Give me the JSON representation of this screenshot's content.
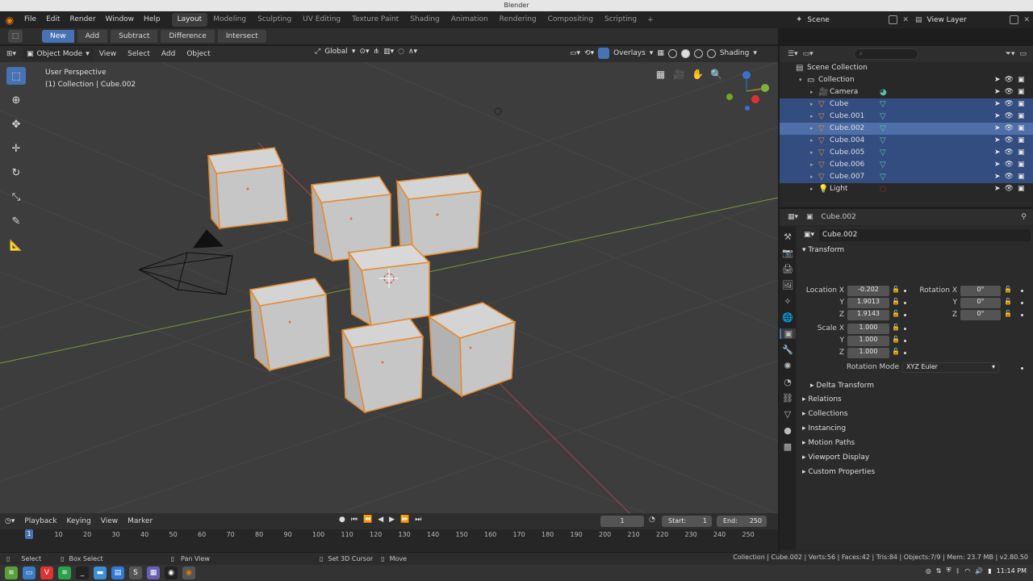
{
  "window": {
    "title": "Blender"
  },
  "menubar": {
    "items": [
      "File",
      "Edit",
      "Render",
      "Window",
      "Help"
    ],
    "workspaces": [
      "Layout",
      "Modeling",
      "Sculpting",
      "UV Editing",
      "Texture Paint",
      "Shading",
      "Animation",
      "Rendering",
      "Compositing",
      "Scripting"
    ],
    "add_workspace": "+",
    "scene_name": "Scene",
    "view_layer_name": "View Layer"
  },
  "toolheader": {
    "buttons": [
      "New",
      "Add",
      "Subtract",
      "Difference",
      "Intersect"
    ]
  },
  "viewport_header": {
    "mode": "Object Mode",
    "menus": [
      "View",
      "Select",
      "Add",
      "Object"
    ],
    "orientation": "Global",
    "overlays": "Overlays",
    "shading": "Shading"
  },
  "viewport": {
    "view_name": "User Perspective",
    "context_line": "(1) Collection | Cube.002"
  },
  "outliner": {
    "search_placeholder": "",
    "rows": [
      {
        "label": "Scene Collection",
        "indent": 0,
        "type": "scene",
        "state": "none"
      },
      {
        "label": "Collection",
        "indent": 1,
        "type": "collection",
        "state": "none"
      },
      {
        "label": "Camera",
        "indent": 2,
        "type": "camera",
        "state": "none"
      },
      {
        "label": "Cube",
        "indent": 2,
        "type": "mesh",
        "state": "selected"
      },
      {
        "label": "Cube.001",
        "indent": 2,
        "type": "mesh",
        "state": "selected"
      },
      {
        "label": "Cube.002",
        "indent": 2,
        "type": "mesh",
        "state": "active"
      },
      {
        "label": "Cube.004",
        "indent": 2,
        "type": "mesh",
        "state": "selected"
      },
      {
        "label": "Cube.005",
        "indent": 2,
        "type": "mesh",
        "state": "selected"
      },
      {
        "label": "Cube.006",
        "indent": 2,
        "type": "mesh",
        "state": "selected"
      },
      {
        "label": "Cube.007",
        "indent": 2,
        "type": "mesh",
        "state": "selected"
      },
      {
        "label": "Light",
        "indent": 2,
        "type": "light",
        "state": "none"
      }
    ]
  },
  "properties": {
    "header_object": "Cube.002",
    "object_name": "Cube.002",
    "transform_title": "Transform",
    "location_label": "Location X",
    "rotation_label": "Rotation X",
    "scale_label": "Scale X",
    "y_label": "Y",
    "z_label": "Z",
    "location": [
      "-0.202",
      "1.9013",
      "1.9143"
    ],
    "rotation": [
      "0°",
      "0°",
      "0°"
    ],
    "scale": [
      "1.000",
      "1.000",
      "1.000"
    ],
    "rotation_mode_label": "Rotation Mode",
    "rotation_mode": "XYZ Euler",
    "delta": "Delta Transform",
    "panels": [
      "Relations",
      "Collections",
      "Instancing",
      "Motion Paths",
      "Viewport Display",
      "Custom Properties"
    ]
  },
  "timeline": {
    "menus": [
      "Playback",
      "Keying",
      "View",
      "Marker"
    ],
    "current_frame": "1",
    "start_label": "Start:",
    "start": "1",
    "end_label": "End:",
    "end": "250",
    "ticks": [
      "0",
      "10",
      "20",
      "30",
      "40",
      "50",
      "60",
      "70",
      "80",
      "90",
      "100",
      "110",
      "120",
      "130",
      "140",
      "150",
      "160",
      "170",
      "180",
      "190",
      "200",
      "210",
      "220",
      "230",
      "240",
      "250"
    ],
    "frame_marker": "1"
  },
  "statusbar": {
    "items": [
      "Select",
      "Box Select",
      "Pan View",
      "Set 3D Cursor",
      "Move"
    ],
    "stats": "Collection | Cube.002 | Verts:56 | Faces:42 | Tris:84 | Objects:7/9 | Mem: 23.7 MB | v2.80.50"
  },
  "taskbar": {
    "clock": "11:14 PM"
  },
  "colors": {
    "accent": "#4772b3",
    "selection": "#e58a2c",
    "bg": "#3d3d3d"
  }
}
